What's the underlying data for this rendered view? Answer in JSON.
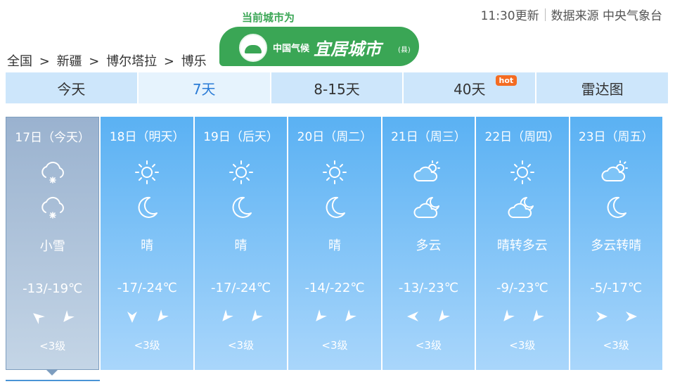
{
  "header": {
    "update_time": "11:30更新",
    "source": "数据来源 中央气象台"
  },
  "badge": {
    "title": "当前城市为",
    "logo_small": "中国气候",
    "logo_big": "宜居城市",
    "logo_tag": "(县)"
  },
  "breadcrumb": {
    "items": [
      "全国",
      ">",
      "新疆",
      ">",
      "博尔塔拉",
      ">",
      "博乐"
    ]
  },
  "tabs": [
    {
      "label": "今天"
    },
    {
      "label": "7天"
    },
    {
      "label": "8-15天"
    },
    {
      "label": "40天",
      "hot": "hot"
    },
    {
      "label": "雷达图"
    }
  ],
  "days": [
    {
      "date": "17日（今天）",
      "day_icon": "snow-cloud-icon",
      "night_icon": "snow-cloud-icon",
      "cond": "小雪",
      "temp": "-13/-19℃",
      "wind_dirs": [
        "northwest-arrow-icon",
        "southwest-arrow-icon"
      ],
      "level": "<3级"
    },
    {
      "date": "18日（明天）",
      "day_icon": "sun-icon",
      "night_icon": "moon-icon",
      "cond": "晴",
      "temp": "-17/-24℃",
      "wind_dirs": [
        "south-arrow-icon",
        "southwest-arrow-icon"
      ],
      "level": "<3级"
    },
    {
      "date": "19日（后天）",
      "day_icon": "sun-icon",
      "night_icon": "moon-icon",
      "cond": "晴",
      "temp": "-17/-24℃",
      "wind_dirs": [
        "southwest-arrow-icon",
        "southwest-arrow-icon"
      ],
      "level": "<3级"
    },
    {
      "date": "20日（周二）",
      "day_icon": "sun-icon",
      "night_icon": "moon-icon",
      "cond": "晴",
      "temp": "-14/-22℃",
      "wind_dirs": [
        "southwest-arrow-icon",
        "southwest-arrow-icon"
      ],
      "level": "<3级"
    },
    {
      "date": "21日（周三）",
      "day_icon": "partly-cloudy-icon",
      "night_icon": "cloudy-night-icon",
      "cond": "多云",
      "temp": "-13/-23℃",
      "wind_dirs": [
        "west-arrow-icon",
        "southwest-arrow-icon"
      ],
      "level": "<3级"
    },
    {
      "date": "22日（周四）",
      "day_icon": "sun-icon",
      "night_icon": "cloudy-night-icon",
      "cond": "晴转多云",
      "temp": "-9/-23℃",
      "wind_dirs": [
        "southwest-arrow-icon",
        "southwest-arrow-icon"
      ],
      "level": "<3级"
    },
    {
      "date": "23日（周五）",
      "day_icon": "partly-cloudy-icon",
      "night_icon": "moon-icon",
      "cond": "多云转晴",
      "temp": "-5/-17℃",
      "wind_dirs": [
        "east-arrow-icon",
        "east-arrow-icon"
      ],
      "level": "<3级"
    }
  ]
}
